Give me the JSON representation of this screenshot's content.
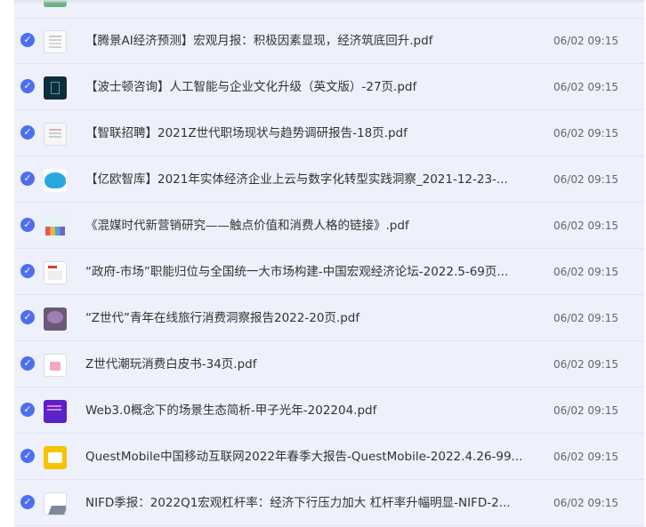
{
  "files": [
    {
      "name": "【腾景AI经济预测】宏观月报：积极因素显现，经济筑底回升.pdf",
      "time": "06/02 09:15",
      "thumb": "doc-icon"
    },
    {
      "name": "【波士顿咨询】人工智能与企业文化升级（英文版）-27页.pdf",
      "time": "06/02 09:15",
      "thumb": "dark-cover-icon"
    },
    {
      "name": "【智联招聘】2021Z世代职场现状与趋势调研报告-18页.pdf",
      "time": "06/02 09:15",
      "thumb": "report-cover-icon"
    },
    {
      "name": "【亿欧智库】2021年实体经济企业上云与数字化转型实践洞察_2021-12-23-...",
      "time": "06/02 09:15",
      "thumb": "cloud-cover-icon"
    },
    {
      "name": "《混媒时代新营销研究——触点价值和消费人格的链接》.pdf",
      "time": "06/02 09:15",
      "thumb": "colorful-cover-icon"
    },
    {
      "name": "“政府-市场”职能归位与全国统一大市场构建-中国宏观经济论坛-2022.5-69页...",
      "time": "06/02 09:15",
      "thumb": "report-cover-icon"
    },
    {
      "name": "“Z世代”青年在线旅行消费洞察报告2022-20页.pdf",
      "time": "06/02 09:15",
      "thumb": "photo-cover-icon"
    },
    {
      "name": "Z世代潮玩消费白皮书-34页.pdf",
      "time": "06/02 09:15",
      "thumb": "illustration-cover-icon"
    },
    {
      "name": "Web3.0概念下的场景生态简析-甲子光年-202204.pdf",
      "time": "06/02 09:15",
      "thumb": "purple-cover-icon"
    },
    {
      "name": "QuestMobile中国移动互联网2022年春季大报告-QuestMobile-2022.4.26-99...",
      "time": "06/02 09:15",
      "thumb": "yellow-cover-icon"
    },
    {
      "name": "NIFD季报：2022Q1宏观杠杆率：经济下行压力加大 杠杆率升幅明显-NIFD-2...",
      "time": "06/02 09:15",
      "thumb": "chart-cover-icon"
    }
  ],
  "colors": {
    "accent": "#4e6ef2",
    "row_bg": "#eef0fb",
    "text": "#333333"
  }
}
